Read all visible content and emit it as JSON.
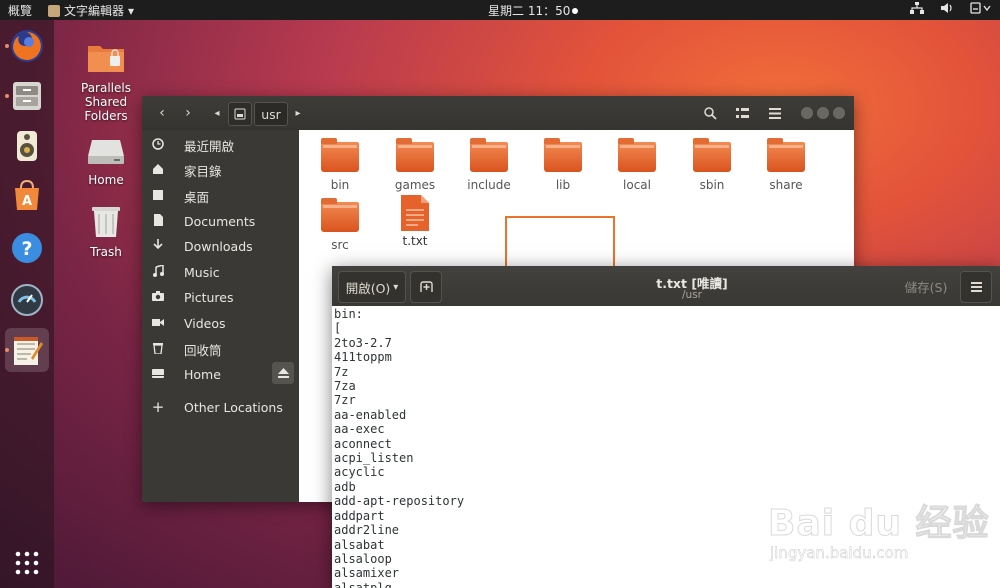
{
  "topbar": {
    "activities": "概覽",
    "app_menu": "文字編輯器",
    "app_menu_arrow": "▾",
    "clock": "星期二 11：50",
    "tray_icons": [
      "network-icon",
      "volume-icon",
      "power-icon"
    ]
  },
  "dock": {
    "items": [
      "firefox-icon",
      "files-icon",
      "rhythmbox-icon",
      "software-center-icon",
      "help-icon",
      "settings-dial-icon",
      "text-editor-icon"
    ],
    "show_apps_icon": "grid-icon"
  },
  "desktop": {
    "icons": [
      {
        "label": "Parallels Shared Folders",
        "icon": "shared-folder-icon"
      },
      {
        "label": "Home",
        "icon": "drive-icon"
      },
      {
        "label": "Trash",
        "icon": "trash-icon"
      }
    ]
  },
  "files": {
    "path_segment": "usr",
    "sidebar": [
      {
        "label": "最近開啟",
        "icon": "clock-icon"
      },
      {
        "label": "家目錄",
        "icon": "home-icon"
      },
      {
        "label": "桌面",
        "icon": "desktop-icon"
      },
      {
        "label": "Documents",
        "icon": "document-icon"
      },
      {
        "label": "Downloads",
        "icon": "download-icon"
      },
      {
        "label": "Music",
        "icon": "music-icon"
      },
      {
        "label": "Pictures",
        "icon": "camera-icon"
      },
      {
        "label": "Videos",
        "icon": "video-icon"
      },
      {
        "label": "回收筒",
        "icon": "trash-icon"
      },
      {
        "label": "Home",
        "icon": "drive-icon"
      },
      {
        "label": "Other Locations",
        "icon": "plus-icon"
      }
    ],
    "items": [
      "bin",
      "games",
      "include",
      "lib",
      "local",
      "sbin",
      "share",
      "src",
      "t.txt"
    ]
  },
  "gedit": {
    "open_label": "開啟(O)",
    "save_label": "儲存(S)",
    "title": "t.txt [唯讀]",
    "subtitle": "/usr",
    "lines": [
      "bin:",
      "[",
      "2to3-2.7",
      "411toppm",
      "7z",
      "7za",
      "7zr",
      "aa-enabled",
      "aa-exec",
      "aconnect",
      "acpi_listen",
      "acyclic",
      "adb",
      "add-apt-repository",
      "addpart",
      "addr2line",
      "alsabat",
      "alsaloop",
      "alsamixer",
      "alsatplg"
    ]
  },
  "watermark": {
    "brand": "Bai du 经验",
    "url": "jingyan.baidu.com"
  },
  "colors": {
    "accent": "#e9742b",
    "folder": "#e5622a",
    "headerbar": "#3b3a36",
    "sidebar": "#3a3935"
  }
}
